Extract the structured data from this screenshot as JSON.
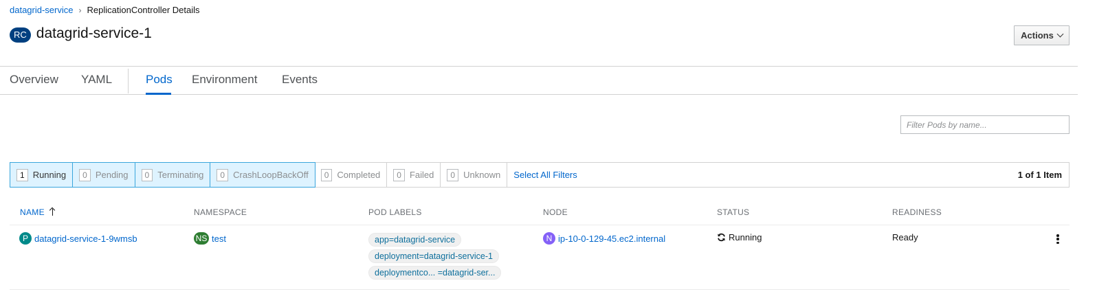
{
  "breadcrumb": {
    "parent": "datagrid-service",
    "current": "ReplicationController Details"
  },
  "header": {
    "badge": "RC",
    "title": "datagrid-service-1",
    "actions_label": "Actions"
  },
  "tabs": [
    {
      "label": "Overview"
    },
    {
      "label": "YAML"
    },
    {
      "label": "Pods",
      "active": true
    },
    {
      "label": "Environment"
    },
    {
      "label": "Events"
    }
  ],
  "filter": {
    "placeholder": "Filter Pods by name..."
  },
  "status_filters": [
    {
      "count": "1",
      "label": "Running",
      "selected": true
    },
    {
      "count": "0",
      "label": "Pending",
      "selected": true
    },
    {
      "count": "0",
      "label": "Terminating",
      "selected": true
    },
    {
      "count": "0",
      "label": "CrashLoopBackOff",
      "selected": true
    },
    {
      "count": "0",
      "label": "Completed",
      "selected": false
    },
    {
      "count": "0",
      "label": "Failed",
      "selected": false
    },
    {
      "count": "0",
      "label": "Unknown",
      "selected": false
    }
  ],
  "select_all_label": "Select All Filters",
  "item_count": "1 of 1 Item",
  "table": {
    "columns": [
      "NAME",
      "NAMESPACE",
      "POD LABELS",
      "NODE",
      "STATUS",
      "READINESS"
    ],
    "sort_icon": "arrow-up-icon",
    "rows": [
      {
        "name_badge": "P",
        "name": "datagrid-service-1-9wmsb",
        "ns_badge": "NS",
        "namespace": "test",
        "labels": [
          "app=datagrid-service",
          "deployment=datagrid-service-1",
          "deploymentco... =datagrid-ser..."
        ],
        "node_badge": "N",
        "node": "ip-10-0-129-45.ec2.internal",
        "status_icon": "sync-icon",
        "status": "Running",
        "readiness": "Ready"
      }
    ]
  },
  "colors": {
    "link": "#0066cc",
    "rc_badge": "#004080",
    "pod_badge": "#008a8a",
    "ns_badge": "#2e7d32",
    "node_badge": "#8461f7",
    "chip_selected_bg": "#def3ff",
    "chip_selected_border": "#39a5dc"
  }
}
